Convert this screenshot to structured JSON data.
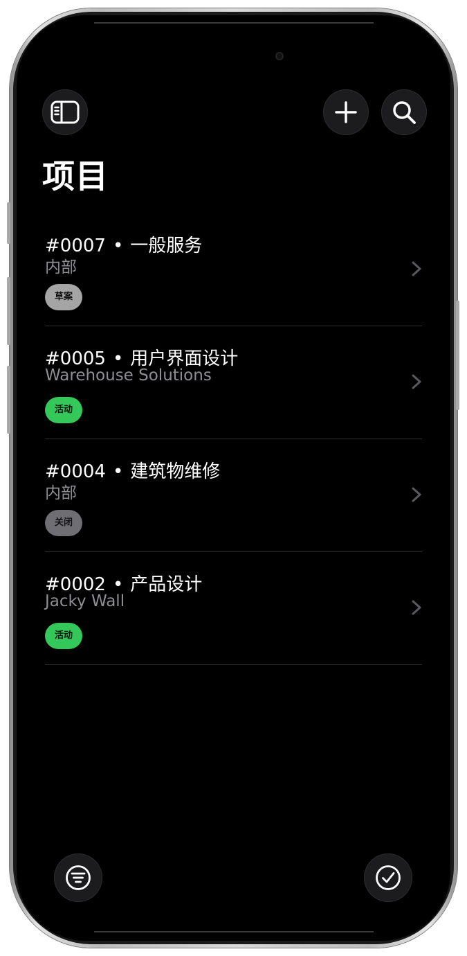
{
  "header": {
    "title": "项目"
  },
  "toolbar": {
    "sidebar_icon": "sidebar-icon",
    "add_icon": "plus-icon",
    "search_icon": "search-icon"
  },
  "projects": [
    {
      "number": "#0007",
      "separator": "•",
      "name": "一般服务",
      "client": "内部",
      "status": "草案",
      "status_color": "#a5a5a5"
    },
    {
      "number": "#0005",
      "separator": "•",
      "name": "用户界面设计",
      "client": "Warehouse Solutions",
      "status": "活动",
      "status_color": "#34c759"
    },
    {
      "number": "#0004",
      "separator": "•",
      "name": "建筑物维修",
      "client": "内部",
      "status": "关闭",
      "status_color": "#6e6e73"
    },
    {
      "number": "#0002",
      "separator": "•",
      "name": "产品设计",
      "client": "Jacky Wall",
      "status": "活动",
      "status_color": "#34c759"
    }
  ],
  "bottom_bar": {
    "filter_icon": "filter-icon",
    "select_icon": "checkmark-circle-icon"
  },
  "colors": {
    "background": "#000000",
    "button_bg": "#1c1c1e",
    "secondary_text": "#8e8e93",
    "active": "#34c759",
    "draft": "#a5a5a5",
    "closed": "#6e6e73"
  }
}
